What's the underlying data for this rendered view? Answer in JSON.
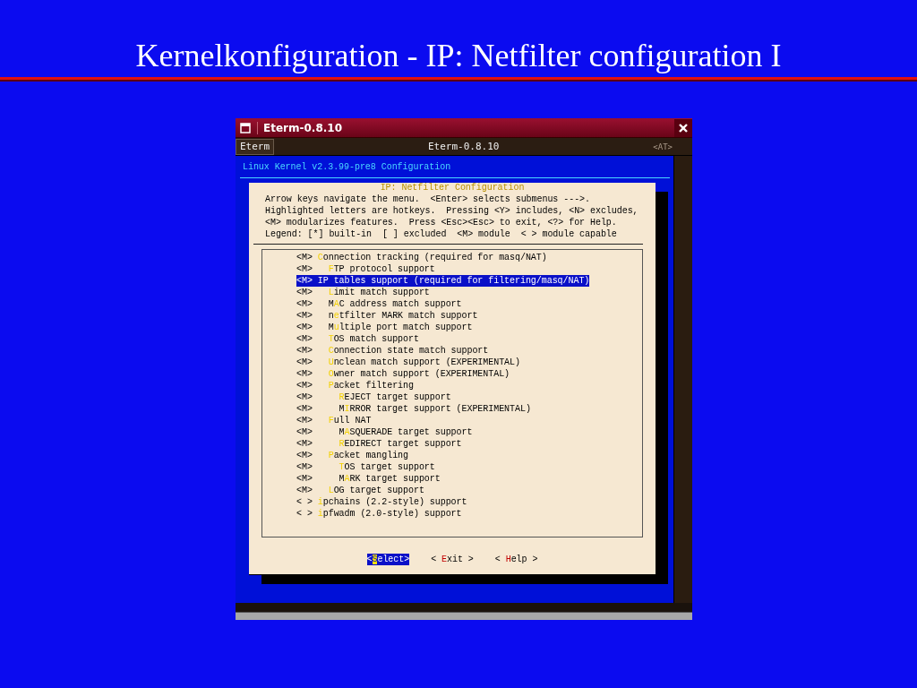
{
  "slide_title": "Kernelkonfiguration - IP: Netfilter configuration I",
  "window": {
    "title": "Eterm-0.8.10",
    "menu_button": "Eterm",
    "bar_title": "Eterm-0.8.10",
    "bar_badge": "<AT>"
  },
  "terminal": {
    "header": "Linux Kernel v2.3.99-pre8 Configuration",
    "dialog": {
      "title": "IP: Netfilter Configuration",
      "instructions": [
        "Arrow keys navigate the menu.  <Enter> selects submenus --->.",
        "Highlighted letters are hotkeys.  Pressing <Y> includes, <N> excludes,",
        "<M> modularizes features.  Press <Esc><Esc> to exit, <?> for Help.",
        "Legend: [*] built-in  [ ] excluded  <M> module  < > module capable"
      ],
      "items": [
        {
          "state": "<M>",
          "hotkey": "C",
          "after": "onnection tracking (required for masq/NAT)",
          "selected": false,
          "children": [
            {
              "state": "<M>",
              "hotkey": "F",
              "after": "TP protocol support",
              "selected": false
            }
          ]
        },
        {
          "state": "<M>",
          "hotkey": "I",
          "after": "P tables support (required for filtering/masq/NAT)",
          "selected": true,
          "children": [
            {
              "state": "<M>",
              "hotkey": "L",
              "after": "imit match support",
              "selected": false
            },
            {
              "state": "<M>",
              "before": "M",
              "hotkey": "A",
              "after": "C address match support",
              "selected": false
            },
            {
              "state": "<M>",
              "before": "n",
              "hotkey": "e",
              "after": "tfilter MARK match support",
              "selected": false
            },
            {
              "state": "<M>",
              "before": "M",
              "hotkey": "u",
              "after": "ltiple port match support",
              "selected": false
            },
            {
              "state": "<M>",
              "hotkey": "T",
              "after": "OS match support",
              "selected": false
            },
            {
              "state": "<M>",
              "hotkey": "C",
              "after": "onnection state match support",
              "selected": false
            },
            {
              "state": "<M>",
              "hotkey": "U",
              "after": "nclean match support (EXPERIMENTAL)",
              "selected": false
            },
            {
              "state": "<M>",
              "hotkey": "O",
              "after": "wner match support (EXPERIMENTAL)",
              "selected": false
            },
            {
              "state": "<M>",
              "hotkey": "P",
              "after": "acket filtering",
              "selected": false,
              "children": [
                {
                  "state": "<M>",
                  "hotkey": "R",
                  "after": "EJECT target support",
                  "selected": false
                },
                {
                  "state": "<M>",
                  "before": "M",
                  "hotkey": "I",
                  "after": "RROR target support (EXPERIMENTAL)",
                  "selected": false
                }
              ]
            },
            {
              "state": "<M>",
              "hotkey": "F",
              "after": "ull NAT",
              "selected": false,
              "children": [
                {
                  "state": "<M>",
                  "before": "M",
                  "hotkey": "A",
                  "after": "SQUERADE target support",
                  "selected": false
                },
                {
                  "state": "<M>",
                  "hotkey": "R",
                  "after": "EDIRECT target support",
                  "selected": false
                }
              ]
            },
            {
              "state": "<M>",
              "hotkey": "P",
              "after": "acket mangling",
              "selected": false,
              "children": [
                {
                  "state": "<M>",
                  "hotkey": "T",
                  "after": "OS target support",
                  "selected": false
                },
                {
                  "state": "<M>",
                  "before": "M",
                  "hotkey": "A",
                  "after": "RK target support",
                  "selected": false
                }
              ]
            },
            {
              "state": "<M>",
              "hotkey": "L",
              "after": "OG target support",
              "selected": false
            }
          ]
        },
        {
          "state": "< >",
          "hotkey": "i",
          "after": "pchains (2.2-style) support",
          "selected": false
        },
        {
          "state": "< >",
          "hotkey": "i",
          "after": "pfwadm (2.0-style) support",
          "selected": false
        }
      ],
      "buttons": [
        {
          "before": "<",
          "hotkey": "S",
          "after": "elect>",
          "selected": true
        },
        {
          "before": "< ",
          "hotkey": "E",
          "after": "xit >",
          "selected": false
        },
        {
          "before": "< ",
          "hotkey": "H",
          "after": "elp >",
          "selected": false
        }
      ]
    }
  }
}
